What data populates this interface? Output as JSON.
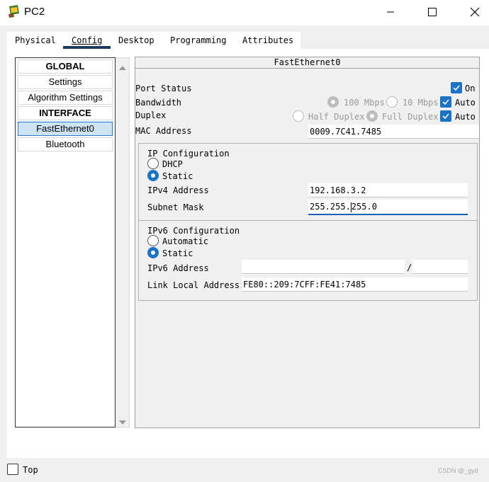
{
  "window": {
    "title": "PC2",
    "icon": "pc-app-icon",
    "controls": [
      "minimize-icon",
      "maximize-icon",
      "close-icon"
    ]
  },
  "tabs": [
    {
      "label": "Physical",
      "active": false
    },
    {
      "label": "Config",
      "active": true
    },
    {
      "label": "Desktop",
      "active": false
    },
    {
      "label": "Programming",
      "active": false
    },
    {
      "label": "Attributes",
      "active": false
    }
  ],
  "sidebar": {
    "items": [
      {
        "label": "GLOBAL",
        "type": "header"
      },
      {
        "label": "Settings",
        "type": "item"
      },
      {
        "label": "Algorithm Settings",
        "type": "item"
      },
      {
        "label": "INTERFACE",
        "type": "header"
      },
      {
        "label": "FastEthernet0",
        "type": "item",
        "selected": true
      },
      {
        "label": "Bluetooth",
        "type": "item"
      }
    ]
  },
  "panel": {
    "title": "FastEthernet0",
    "port_status": {
      "label": "Port Status",
      "on_label": "On",
      "on": true
    },
    "bandwidth": {
      "label": "Bandwidth",
      "opt1": "100 Mbps",
      "opt2": "10 Mbps",
      "auto_label": "Auto",
      "auto": true
    },
    "duplex": {
      "label": "Duplex",
      "opt1": "Half Duplex",
      "opt2": "Full Duplex",
      "auto_label": "Auto",
      "auto": true
    },
    "mac": {
      "label": "MAC Address",
      "value": "0009.7C41.7485"
    },
    "ipv4": {
      "title": "IP Configuration",
      "dhcp_label": "DHCP",
      "static_label": "Static",
      "mode": "static",
      "address_label": "IPv4 Address",
      "address_value": "192.168.3.2",
      "mask_label": "Subnet Mask",
      "mask_value_a": "255.255.",
      "mask_value_b": "255.0"
    },
    "ipv6": {
      "title": "IPv6 Configuration",
      "automatic_label": "Automatic",
      "static_label": "Static",
      "mode": "static",
      "address_label": "IPv6 Address",
      "address_value": "",
      "prefix_sep": "/",
      "prefix_value": "",
      "link_local_label": "Link Local Address:",
      "link_local_value": "FE80::209:7CFF:FE41:7485"
    }
  },
  "footer": {
    "top_label": "Top",
    "top_checked": false,
    "watermark": "CSDN @_gyd"
  },
  "colors": {
    "accent": "#1a73c7",
    "tab_underline": "#1c3c5c",
    "selected_item": "#cde4f7"
  }
}
